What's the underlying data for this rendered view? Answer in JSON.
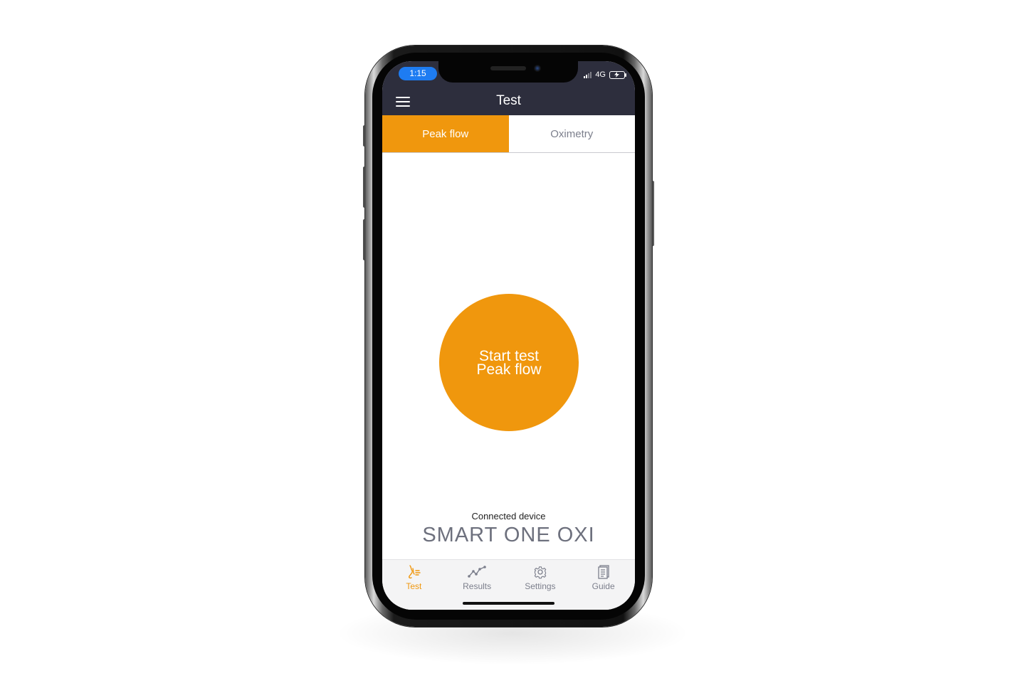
{
  "status_bar": {
    "time": "1:15",
    "network": "4G"
  },
  "header": {
    "title": "Test"
  },
  "tabs": [
    {
      "label": "Peak flow",
      "active": true
    },
    {
      "label": "Oximetry",
      "active": false
    }
  ],
  "start_button": {
    "line1": "Start test",
    "line2": "Peak flow"
  },
  "device": {
    "label": "Connected device",
    "name": "SMART ONE OXI"
  },
  "bottom_nav": [
    {
      "label": "Test",
      "icon": "lungs-icon",
      "active": true
    },
    {
      "label": "Results",
      "icon": "trend-line-icon",
      "active": false
    },
    {
      "label": "Settings",
      "icon": "gear-icon",
      "active": false
    },
    {
      "label": "Guide",
      "icon": "document-icon",
      "active": false
    }
  ],
  "colors": {
    "accent": "#f0970d",
    "header_bg": "#2d2e3d",
    "inactive_text": "#7c7f8c",
    "time_pill": "#1e7cf2"
  }
}
